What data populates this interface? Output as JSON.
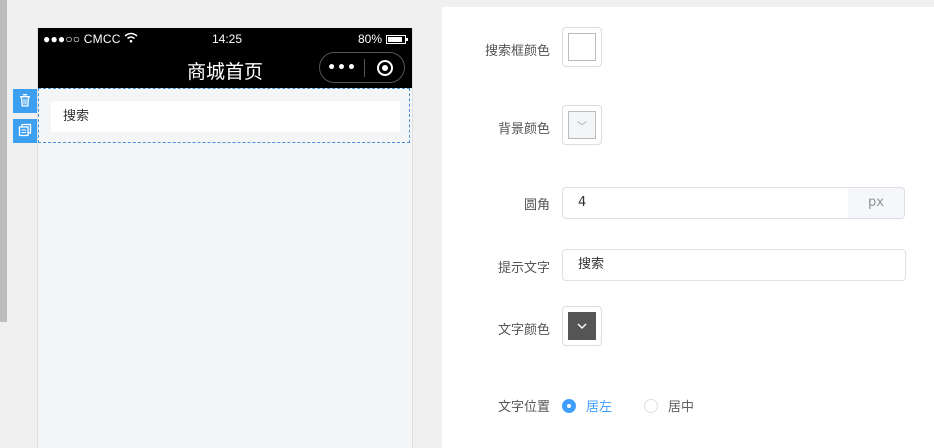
{
  "status_bar": {
    "carrier": "●●●○○ CMCC",
    "time": "14:25",
    "battery": "80%"
  },
  "page": {
    "title": "商城首页",
    "more_icon": "more-dots-icon",
    "capsule_icon": "target-icon"
  },
  "preview": {
    "search_placeholder": "搜索"
  },
  "side_actions": {
    "delete_icon": "trash-icon",
    "copy_icon": "copy-icon"
  },
  "settings": {
    "search_box_color": {
      "label": "搜索框颜色",
      "value": "#ffffff"
    },
    "background_color": {
      "label": "背景颜色",
      "value": "#f4f5f7"
    },
    "radius": {
      "label": "圆角",
      "value": "4",
      "unit": "px"
    },
    "placeholder_text": {
      "label": "提示文字",
      "value": "搜索"
    },
    "text_color": {
      "label": "文字颜色",
      "value": "#555555"
    },
    "text_position": {
      "label": "文字位置",
      "options": [
        "居左",
        "居中"
      ],
      "selected": "居左"
    }
  },
  "colors": {
    "accent": "#409eff",
    "selection_border": "#4a90d9"
  }
}
